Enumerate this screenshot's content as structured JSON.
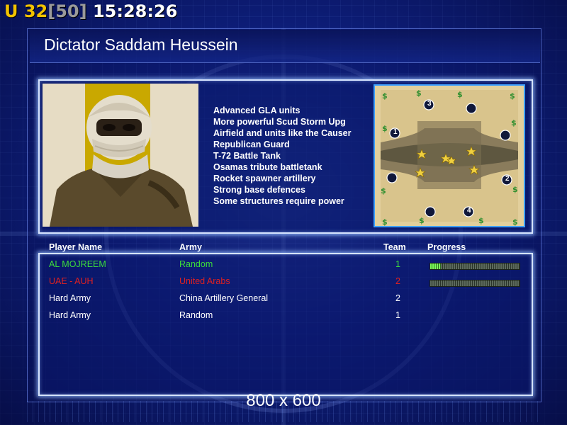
{
  "hud": {
    "u": "U",
    "count": "32",
    "max_open": "[",
    "max": "50",
    "max_close": "]",
    "clock": "15:28:26"
  },
  "title": "Dictator Saddam Heussein",
  "features": [
    "Advanced GLA units",
    "More powerful Scud Storm Upg",
    "Airfield and units like the Causer",
    "Republican Guard",
    "T-72 Battle Tank",
    "Osamas tribute battletank",
    "Rocket spawner artillery",
    "Strong base defences",
    "Some structures require power"
  ],
  "minimap": {
    "start_labels": [
      "1",
      "2",
      "3",
      "4"
    ]
  },
  "table": {
    "headers": {
      "player": "Player Name",
      "army": "Army",
      "team": "Team",
      "progress": "Progress"
    },
    "rows": [
      {
        "player": "AL MOJREEM",
        "army": "Random",
        "team": "1",
        "color": "#3cdc3c",
        "progress": 0.12
      },
      {
        "player": "UAE - AUH",
        "army": "United Arabs",
        "team": "2",
        "color": "#e02020",
        "progress": 0.0
      },
      {
        "player": "Hard Army",
        "army": "China Artillery General",
        "team": "2",
        "color": "#ffffff"
      },
      {
        "player": "Hard Army",
        "army": "Random",
        "team": "1",
        "color": "#ffffff"
      }
    ]
  },
  "resolution": "800 x 600",
  "colors": {
    "accent": "#f2c200",
    "background": "#0c1c78",
    "panel_border": "#d6e4ff",
    "minimap_border": "#3fa0ff"
  }
}
